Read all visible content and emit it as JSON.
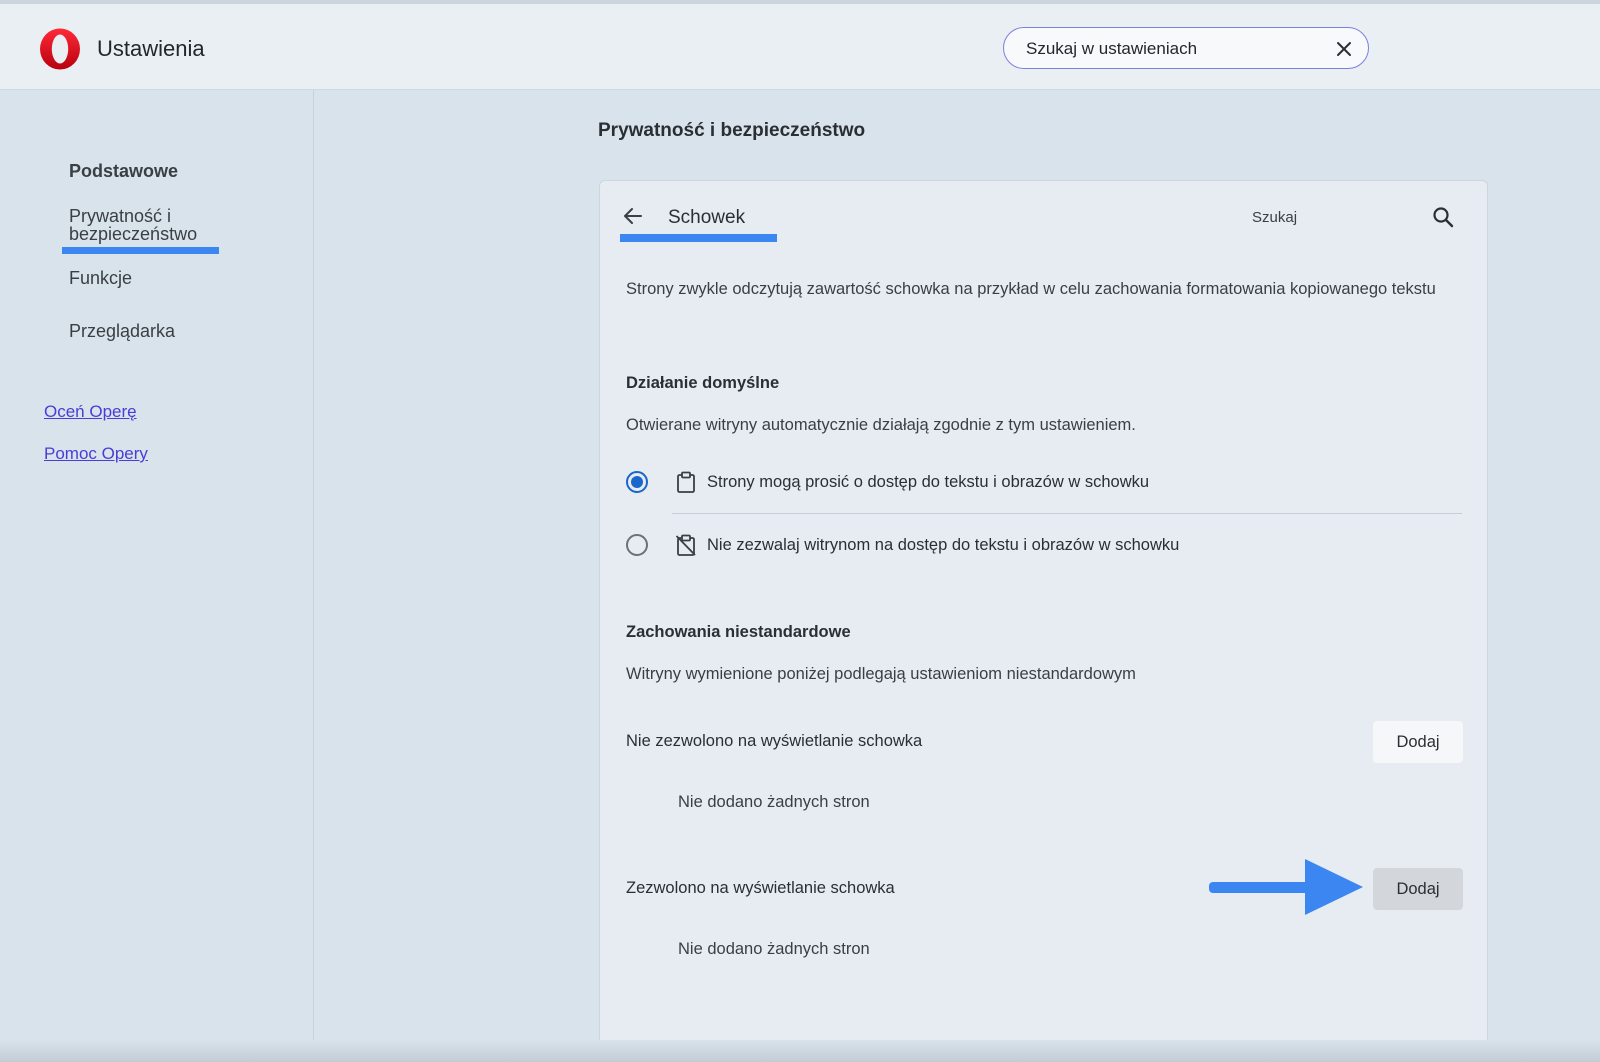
{
  "header": {
    "app_title": "Ustawienia",
    "search_placeholder": "Szukaj w ustawieniach"
  },
  "sidebar": {
    "items": [
      {
        "label": "Podstawowe"
      },
      {
        "label": "Prywatność i bezpieczeństwo",
        "line1": "Prywatność i",
        "line2": "bezpieczeństwo",
        "active": true
      },
      {
        "label": "Funkcje"
      },
      {
        "label": "Przeglądarka"
      }
    ],
    "links": [
      {
        "label": "Oceń Operę"
      },
      {
        "label": "Pomoc Opery"
      }
    ]
  },
  "main": {
    "section_title": "Prywatność i bezpieczeństwo",
    "card": {
      "title": "Schowek",
      "search_label": "Szukaj",
      "description": "Strony zwykle odczytują zawartość schowka na przykład w celu zachowania formatowania kopiowanego tekstu",
      "default_behavior": {
        "heading": "Działanie domyślne",
        "text": "Otwierane witryny automatycznie działają zgodnie z tym ustawieniem.",
        "options": [
          {
            "label": "Strony mogą prosić o dostęp do tekstu i obrazów w schowku",
            "icon": "clipboard-icon",
            "selected": true
          },
          {
            "label": "Nie zezwalaj witrynom na dostęp do tekstu i obrazów w schowku",
            "icon": "clipboard-blocked-icon",
            "selected": false
          }
        ]
      },
      "custom_behavior": {
        "heading": "Zachowania niestandardowe",
        "text": "Witryny wymienione poniżej podlegają ustawieniom niestandardowym",
        "blocked": {
          "label": "Nie zezwolono na wyświetlanie schowka",
          "add_label": "Dodaj",
          "empty": "Nie dodano żadnych stron"
        },
        "allowed": {
          "label": "Zezwolono na wyświetlanie schowka",
          "add_label": "Dodaj",
          "empty": "Nie dodano żadnych stron"
        }
      }
    }
  },
  "colors": {
    "accent_blue": "#3b86f0",
    "radio_blue": "#1a66c9",
    "link_purple": "#4b3cd6",
    "opera_red": "#e8192c"
  }
}
